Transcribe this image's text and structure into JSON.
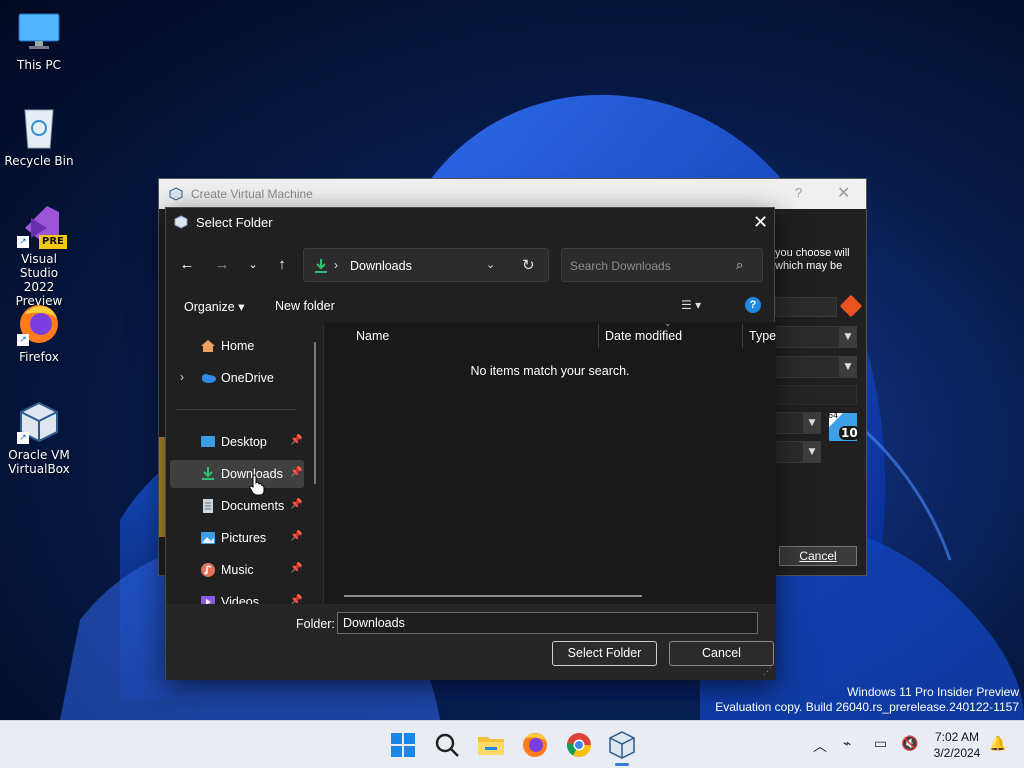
{
  "desktop": {
    "icons": [
      {
        "label": "This PC"
      },
      {
        "label": "Recycle Bin"
      },
      {
        "label": "Visual Studio\n2022 Preview",
        "line1": "Visual Studio",
        "line2": "2022 Preview",
        "badge": "PRE"
      },
      {
        "label": "Firefox"
      },
      {
        "label": "Oracle VM\nVirtualBox",
        "line1": "Oracle VM",
        "line2": "VirtualBox"
      }
    ]
  },
  "vm_window": {
    "title": "Create Virtual Machine",
    "help": "?",
    "close": "✕",
    "side_text_line1": "you choose will",
    "side_text_line2": "which may be",
    "os_badge_top": "64",
    "os_badge_num": "10",
    "cancel_label": "Cancel"
  },
  "dialog": {
    "title": "Select Folder",
    "address": {
      "current": "Downloads",
      "separator": "›"
    },
    "search": {
      "placeholder": "Search Downloads"
    },
    "toolbar": {
      "organize": "Organize ▾",
      "new_folder": "New folder",
      "help": "?"
    },
    "nav": {
      "home": "Home",
      "onedrive": "OneDrive",
      "items": [
        {
          "label": "Desktop",
          "icon": "desktop-icon"
        },
        {
          "label": "Downloads",
          "icon": "download-icon",
          "selected": true
        },
        {
          "label": "Documents",
          "icon": "document-icon"
        },
        {
          "label": "Pictures",
          "icon": "pictures-icon"
        },
        {
          "label": "Music",
          "icon": "music-icon"
        },
        {
          "label": "Videos",
          "icon": "videos-icon"
        }
      ]
    },
    "columns": [
      "Name",
      "Date modified",
      "Type"
    ],
    "empty_message": "No items match your search.",
    "folder_label": "Folder:",
    "folder_value": "Downloads",
    "select_button": "Select Folder",
    "cancel_button": "Cancel"
  },
  "watermark": {
    "line1": "Windows 11 Pro Insider Preview",
    "line2": "Evaluation copy. Build 26040.rs_prerelease.240122-1157"
  },
  "taskbar": {
    "apps": [
      "start-icon",
      "search-icon",
      "file-explorer-icon",
      "firefox-icon",
      "chrome-icon",
      "virtualbox-icon"
    ],
    "time": "7:02 AM",
    "date": "3/2/2024"
  },
  "colors": {
    "accent": "#1e88e5",
    "download_green": "#2fbf71",
    "selected_bg": "#404040"
  }
}
